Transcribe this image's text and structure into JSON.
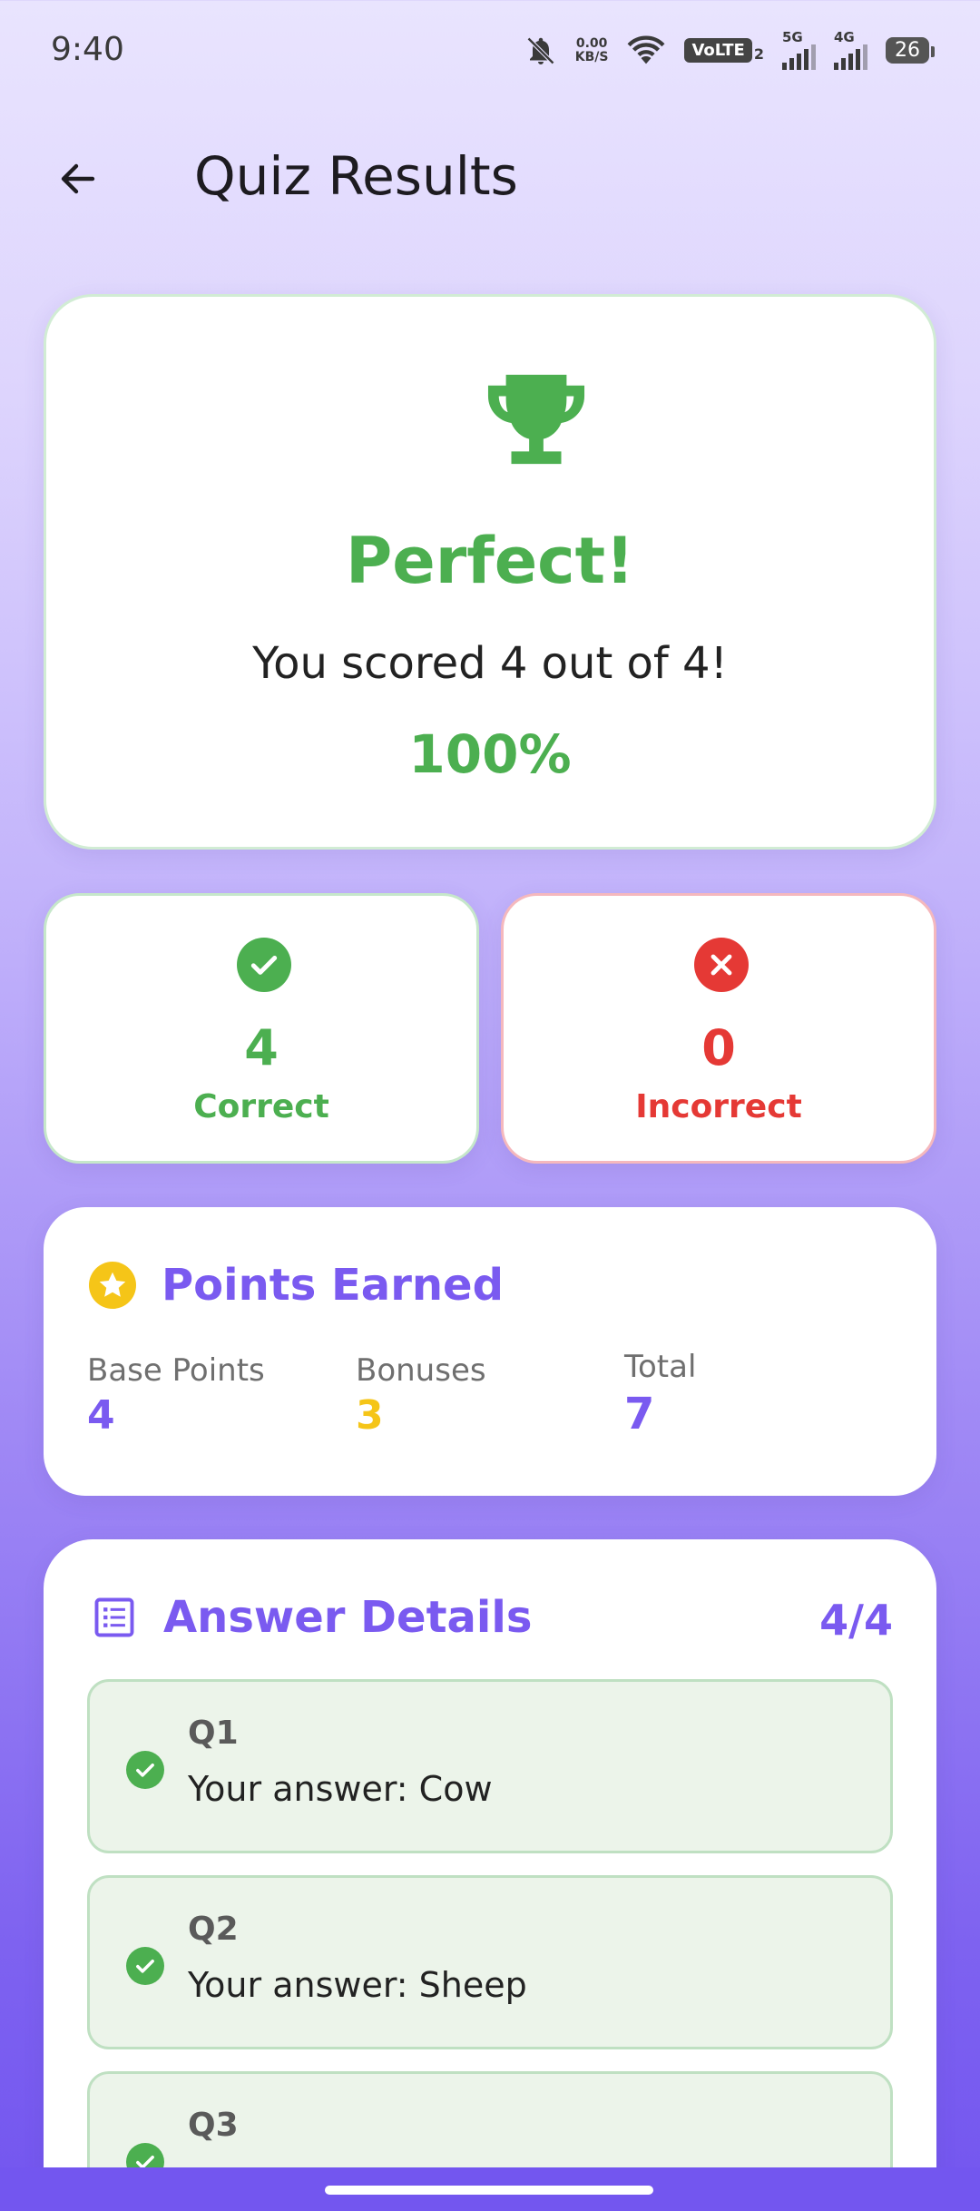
{
  "status_bar": {
    "time": "9:40",
    "speed_value": "0.00",
    "speed_unit": "KB/S",
    "volte": "VoLTE",
    "volte_sub": "2",
    "net1": "5G",
    "net2": "4G",
    "battery": "26",
    "icons": [
      "bell-off-icon",
      "wifi-icon",
      "signal-icon",
      "battery-icon"
    ]
  },
  "app_bar": {
    "title": "Quiz Results",
    "back_icon": "arrow-left-icon"
  },
  "result": {
    "icon": "trophy-icon",
    "headline": "Perfect!",
    "score_text": "You scored 4 out of 4!",
    "percentage": "100%"
  },
  "stats": {
    "correct": {
      "count": "4",
      "label": "Correct",
      "color": "#4caf50",
      "icon": "check-circle-icon"
    },
    "incorrect": {
      "count": "0",
      "label": "Incorrect",
      "color": "#e53935",
      "icon": "x-circle-icon"
    }
  },
  "points": {
    "title": "Points Earned",
    "icon": "star-icon",
    "base_label": "Base Points",
    "base_value": "4",
    "bonus_label": "Bonuses",
    "bonus_value": "3",
    "total_label": "Total",
    "total_value": "7",
    "colors": {
      "accent": "#7a5af0",
      "bonus": "#f5c518"
    }
  },
  "answers": {
    "title": "Answer Details",
    "icon": "list-icon",
    "count": "4/4",
    "items": [
      {
        "q": "Q1",
        "answer": "Your answer: Cow"
      },
      {
        "q": "Q2",
        "answer": "Your answer: Sheep"
      },
      {
        "q": "Q3",
        "answer": ""
      }
    ]
  }
}
